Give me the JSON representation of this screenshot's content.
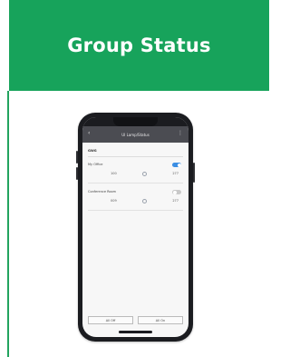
{
  "header": {
    "title": "Group Status"
  },
  "phone": {
    "app_bar": {
      "title": "UI Lamp/Status",
      "back_icon": "back-icon",
      "menu_icon": "menu-icon"
    },
    "section": {
      "title": "GWG"
    },
    "groups": [
      {
        "name": "My Office",
        "left_value": "100",
        "right_value": "277",
        "toggle_on": true
      },
      {
        "name": "Conference Room",
        "left_value": "009",
        "right_value": "277",
        "toggle_on": false
      }
    ],
    "buttons": {
      "left": "All Off",
      "right": "All On"
    }
  },
  "colors": {
    "header_green": "#17a35b",
    "phone_frame": "#1b1c20",
    "toggle_blue": "#3b8ee3"
  }
}
